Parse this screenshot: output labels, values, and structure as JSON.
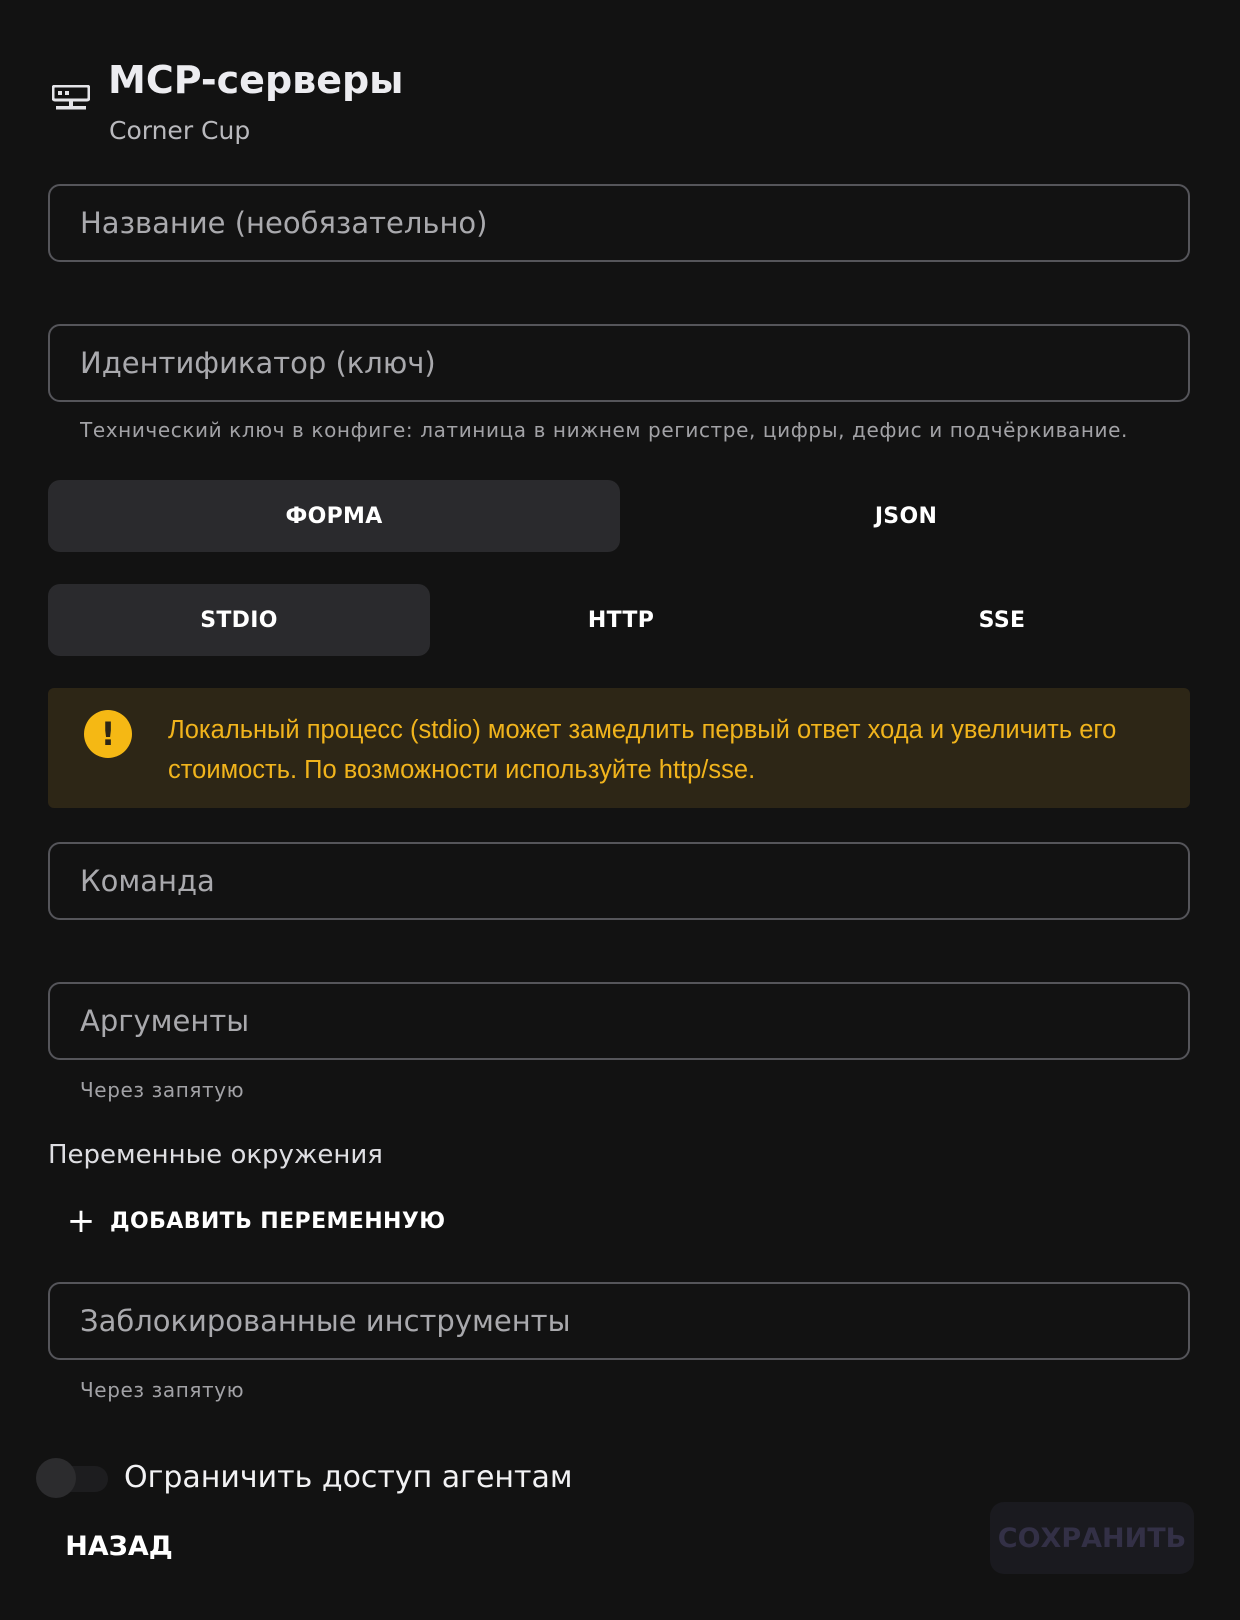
{
  "header": {
    "icon": "server-icon",
    "title": "MCP-серверы",
    "subtitle": "Corner Cup"
  },
  "form": {
    "name_placeholder": "Название (необязательно)",
    "id_placeholder": "Идентификатор (ключ)",
    "id_helper": "Технический ключ в конфиге: латиница в нижнем регистре, цифры, дефис и подчёркивание.",
    "mode_tabs": [
      {
        "label": "ФОРМА",
        "active": true
      },
      {
        "label": "JSON",
        "active": false
      }
    ],
    "transport_tabs": [
      {
        "label": "STDIO",
        "active": true
      },
      {
        "label": "HTTP",
        "active": false
      },
      {
        "label": "SSE",
        "active": false
      }
    ],
    "alert": {
      "icon": "exclamation-icon",
      "text": "Локальный процесс (stdio) может замедлить первый ответ хода и увеличить его стоимость. По возможности используйте http/sse."
    },
    "command_placeholder": "Команда",
    "args_placeholder": "Аргументы",
    "args_helper": "Через запятую",
    "env_label": "Переменные окружения",
    "add_env_label": "ДОБАВИТЬ ПЕРЕМЕННУЮ",
    "blocked_placeholder": "Заблокированные инструменты",
    "blocked_helper": "Через запятую",
    "restrict_label": "Ограничить доступ агентам",
    "restrict_on": false
  },
  "actions": {
    "back_label": "НАЗАД",
    "save_label": "СОХРАНИТЬ"
  },
  "colors": {
    "background": "#121212",
    "alert_bg": "#2d2616",
    "alert_text": "#f1b41c",
    "alert_icon": "#f5b814",
    "segment_active": "#2a2a2d"
  }
}
